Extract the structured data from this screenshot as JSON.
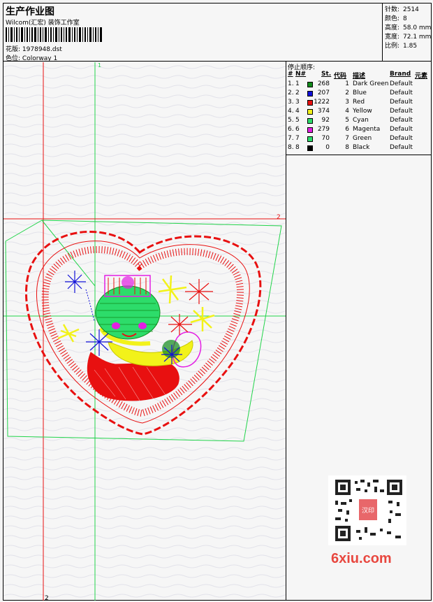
{
  "header": {
    "title": "生产作业图",
    "studio": "Wilcom(汇宏) 装饰工作室",
    "pattern_label": "花版:",
    "pattern_value": "1978948.dst",
    "colorway_label": "色位:",
    "colorway_value": "Colorway 1"
  },
  "stats": [
    {
      "label": "针数:",
      "value": "2514"
    },
    {
      "label": "颜色:",
      "value": "8"
    },
    {
      "label": "高度:",
      "value": "58.0 mm"
    },
    {
      "label": "宽度:",
      "value": "72.1 mm"
    },
    {
      "label": "比例:",
      "value": "1.85"
    }
  ],
  "stop_sequence": {
    "title": "停止顺序:",
    "columns": {
      "num": "#",
      "n": "N#",
      "st": "St.",
      "code": "代码",
      "desc": "描述",
      "brand": "Brand",
      "elem": "元素"
    },
    "rows": [
      {
        "num": "1.",
        "n": "1",
        "color": "#118a1b",
        "st": "268",
        "code": "1",
        "desc": "Dark Green",
        "brand": "Default"
      },
      {
        "num": "2.",
        "n": "2",
        "color": "#1010d8",
        "st": "207",
        "code": "2",
        "desc": "Blue",
        "brand": "Default"
      },
      {
        "num": "3.",
        "n": "3",
        "color": "#e81010",
        "st": "1222",
        "code": "3",
        "desc": "Red",
        "brand": "Default"
      },
      {
        "num": "4.",
        "n": "4",
        "color": "#f2f21a",
        "st": "374",
        "code": "4",
        "desc": "Yellow",
        "brand": "Default"
      },
      {
        "num": "5.",
        "n": "5",
        "color": "#2ddc6a",
        "st": "92",
        "code": "5",
        "desc": "Cyan",
        "brand": "Default"
      },
      {
        "num": "6.",
        "n": "6",
        "color": "#e31ee3",
        "st": "279",
        "code": "6",
        "desc": "Magenta",
        "brand": "Default"
      },
      {
        "num": "7.",
        "n": "7",
        "color": "#2ddc6a",
        "st": "70",
        "code": "7",
        "desc": "Green",
        "brand": "Default"
      },
      {
        "num": "8.",
        "n": "8",
        "color": "#000000",
        "st": "0",
        "code": "8",
        "desc": "Black",
        "brand": "Default"
      }
    ]
  },
  "guides": {
    "v_green": "1",
    "h_red": "2",
    "v_red_bottom": "2"
  },
  "watermark": {
    "site": "6xiu.com",
    "seal": "汉印"
  },
  "colors": {
    "frame_line": "#21d44a",
    "guide_red": "#e81010",
    "logo_red": "#e8473f"
  }
}
